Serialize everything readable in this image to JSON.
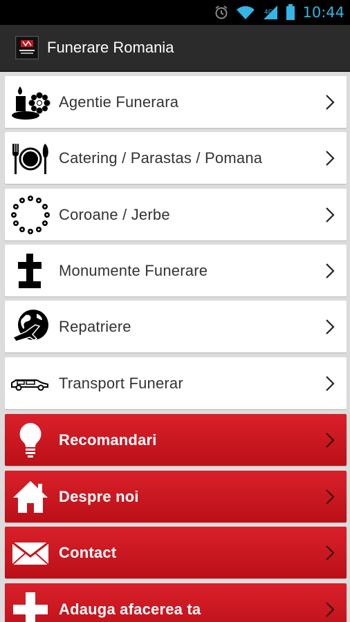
{
  "status_bar": {
    "time": "10:44"
  },
  "app": {
    "title": "Funerare Romania"
  },
  "menu": {
    "items": [
      {
        "label": "Agentie Funerara",
        "icon": "candle-flower-icon",
        "style": "white"
      },
      {
        "label": "Catering / Parastas / Pomana",
        "icon": "plate-cutlery-icon",
        "style": "white"
      },
      {
        "label": "Coroane / Jerbe",
        "icon": "wreath-icon",
        "style": "white"
      },
      {
        "label": "Monumente Funerare",
        "icon": "tombstone-cross-icon",
        "style": "white"
      },
      {
        "label": "Repatriere",
        "icon": "globe-plane-icon",
        "style": "white"
      },
      {
        "label": "Transport Funerar",
        "icon": "hearse-car-icon",
        "style": "white"
      },
      {
        "label": "Recomandari",
        "icon": "lightbulb-icon",
        "style": "red"
      },
      {
        "label": "Despre noi",
        "icon": "home-icon",
        "style": "red"
      },
      {
        "label": "Contact",
        "icon": "envelope-icon",
        "style": "red"
      },
      {
        "label": "Adauga afacerea ta",
        "icon": "plus-icon",
        "style": "red"
      }
    ]
  },
  "colors": {
    "accent_red": "#c8141c",
    "status_blue": "#33b5e5",
    "action_bar": "#2b2b2b"
  }
}
